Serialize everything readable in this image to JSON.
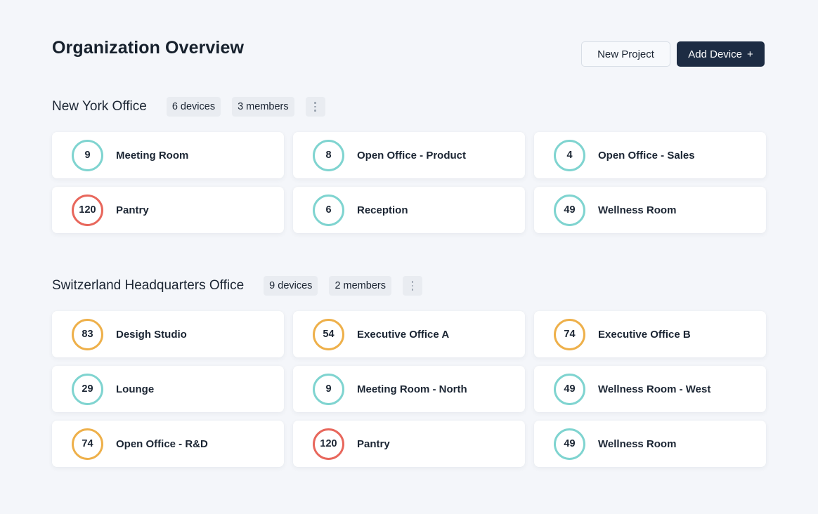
{
  "page": {
    "title": "Organization Overview",
    "actions": {
      "new_project": "New Project",
      "add_device": "Add Device",
      "add_device_icon": "plus-icon"
    }
  },
  "colors": {
    "teal": "#7fd4d0",
    "red": "#e8675c",
    "orange": "#eeb04a",
    "primary": "#1d2c43"
  },
  "sections": [
    {
      "title": "New York Office",
      "devices": "6 devices",
      "members": "3 members",
      "rooms": [
        {
          "count": "9",
          "name": "Meeting Room",
          "status": "teal"
        },
        {
          "count": "8",
          "name": "Open Office - Product",
          "status": "teal"
        },
        {
          "count": "4",
          "name": "Open Office - Sales",
          "status": "teal"
        },
        {
          "count": "120",
          "name": "Pantry",
          "status": "red"
        },
        {
          "count": "6",
          "name": "Reception",
          "status": "teal"
        },
        {
          "count": "49",
          "name": "Wellness Room",
          "status": "teal"
        }
      ]
    },
    {
      "title": "Switzerland Headquarters Office",
      "devices": "9 devices",
      "members": "2 members",
      "rooms": [
        {
          "count": "83",
          "name": "Desigh Studio",
          "status": "orange"
        },
        {
          "count": "54",
          "name": "Executive Office A",
          "status": "orange"
        },
        {
          "count": "74",
          "name": "Executive Office B",
          "status": "orange"
        },
        {
          "count": "29",
          "name": "Lounge",
          "status": "teal"
        },
        {
          "count": "9",
          "name": "Meeting Room - North",
          "status": "teal"
        },
        {
          "count": "49",
          "name": "Wellness Room - West",
          "status": "teal"
        },
        {
          "count": "74",
          "name": "Open Office - R&D",
          "status": "orange"
        },
        {
          "count": "120",
          "name": "Pantry",
          "status": "red"
        },
        {
          "count": "49",
          "name": "Wellness Room",
          "status": "teal"
        }
      ]
    }
  ]
}
